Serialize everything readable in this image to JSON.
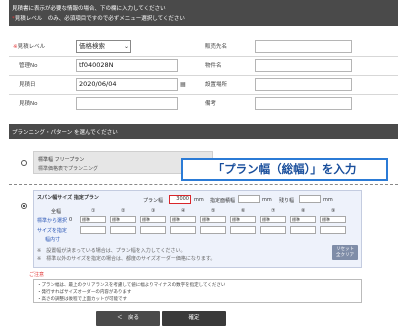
{
  "header": {
    "line1": "見積書に表示が必要な情報の場合、下の欄に入力してください",
    "line2_mark": "*",
    "line2": "見積レベル　のみ、必須項目ですので必ずメニュー選択してください"
  },
  "form": {
    "level_label": "見積レベル",
    "level_req": "※",
    "level_value": "価格検索",
    "manage_label": "管理No",
    "manage_value": "tf040028N",
    "date_label": "見積日",
    "date_value": "2020/06/04",
    "calendar_icon": "calendar-icon",
    "remarks_label": "見積No",
    "customer_label": "販売先名",
    "property_label": "物件名",
    "site_label": "設置場所",
    "note_label": "備考"
  },
  "section": {
    "title": "プランニング・パターン を選んでください"
  },
  "plan_free": {
    "title": "標準幅 フリープラン",
    "subtitle": "標準価格表でプランニング"
  },
  "callout": {
    "text": "「プラン幅（総幅）」を入力"
  },
  "span_plan": {
    "title": "スパン幅サイズ 指定プラン",
    "plan_width_label": "プラン幅",
    "plan_width_value": "3000",
    "unit_mm": "mm",
    "total_label": "指定面積幅",
    "remaining_label": "残り幅",
    "col_total": "全幅",
    "cols": [
      "①",
      "②",
      "③",
      "④",
      "⑤",
      "⑥",
      "⑦",
      "⑧",
      "⑨"
    ],
    "row_select_label": "標準から選択",
    "row_size_label": "サイズを指定",
    "row_size_sub": "幅内寸",
    "std_label": "標準",
    "zero": "0",
    "note1": "※　設置幅が決まっている場合は、プラン幅を入力してください。",
    "note2": "※　標準以外のサイズを指定の場合は、都度のサイズオーダー価格になります。",
    "reset_line1": "リセット",
    "reset_line2": "全クリア"
  },
  "notes": {
    "head": "ご注意",
    "lines": [
      "・プラン幅は、最上のクリアランスを考慮して値に幅よりマイナスの数字を指定してください",
      "・発行すればサイズオーダーの内容があります",
      "・高さの調整は後程で上面カットが可能です"
    ]
  },
  "buttons": {
    "back": "＜　戻る",
    "confirm": "確定"
  },
  "colors": {
    "header_bg": "#4a4a4a",
    "required": "#e23b3b",
    "callout_border": "#2b7bd6",
    "highlight": "#d9262b"
  }
}
